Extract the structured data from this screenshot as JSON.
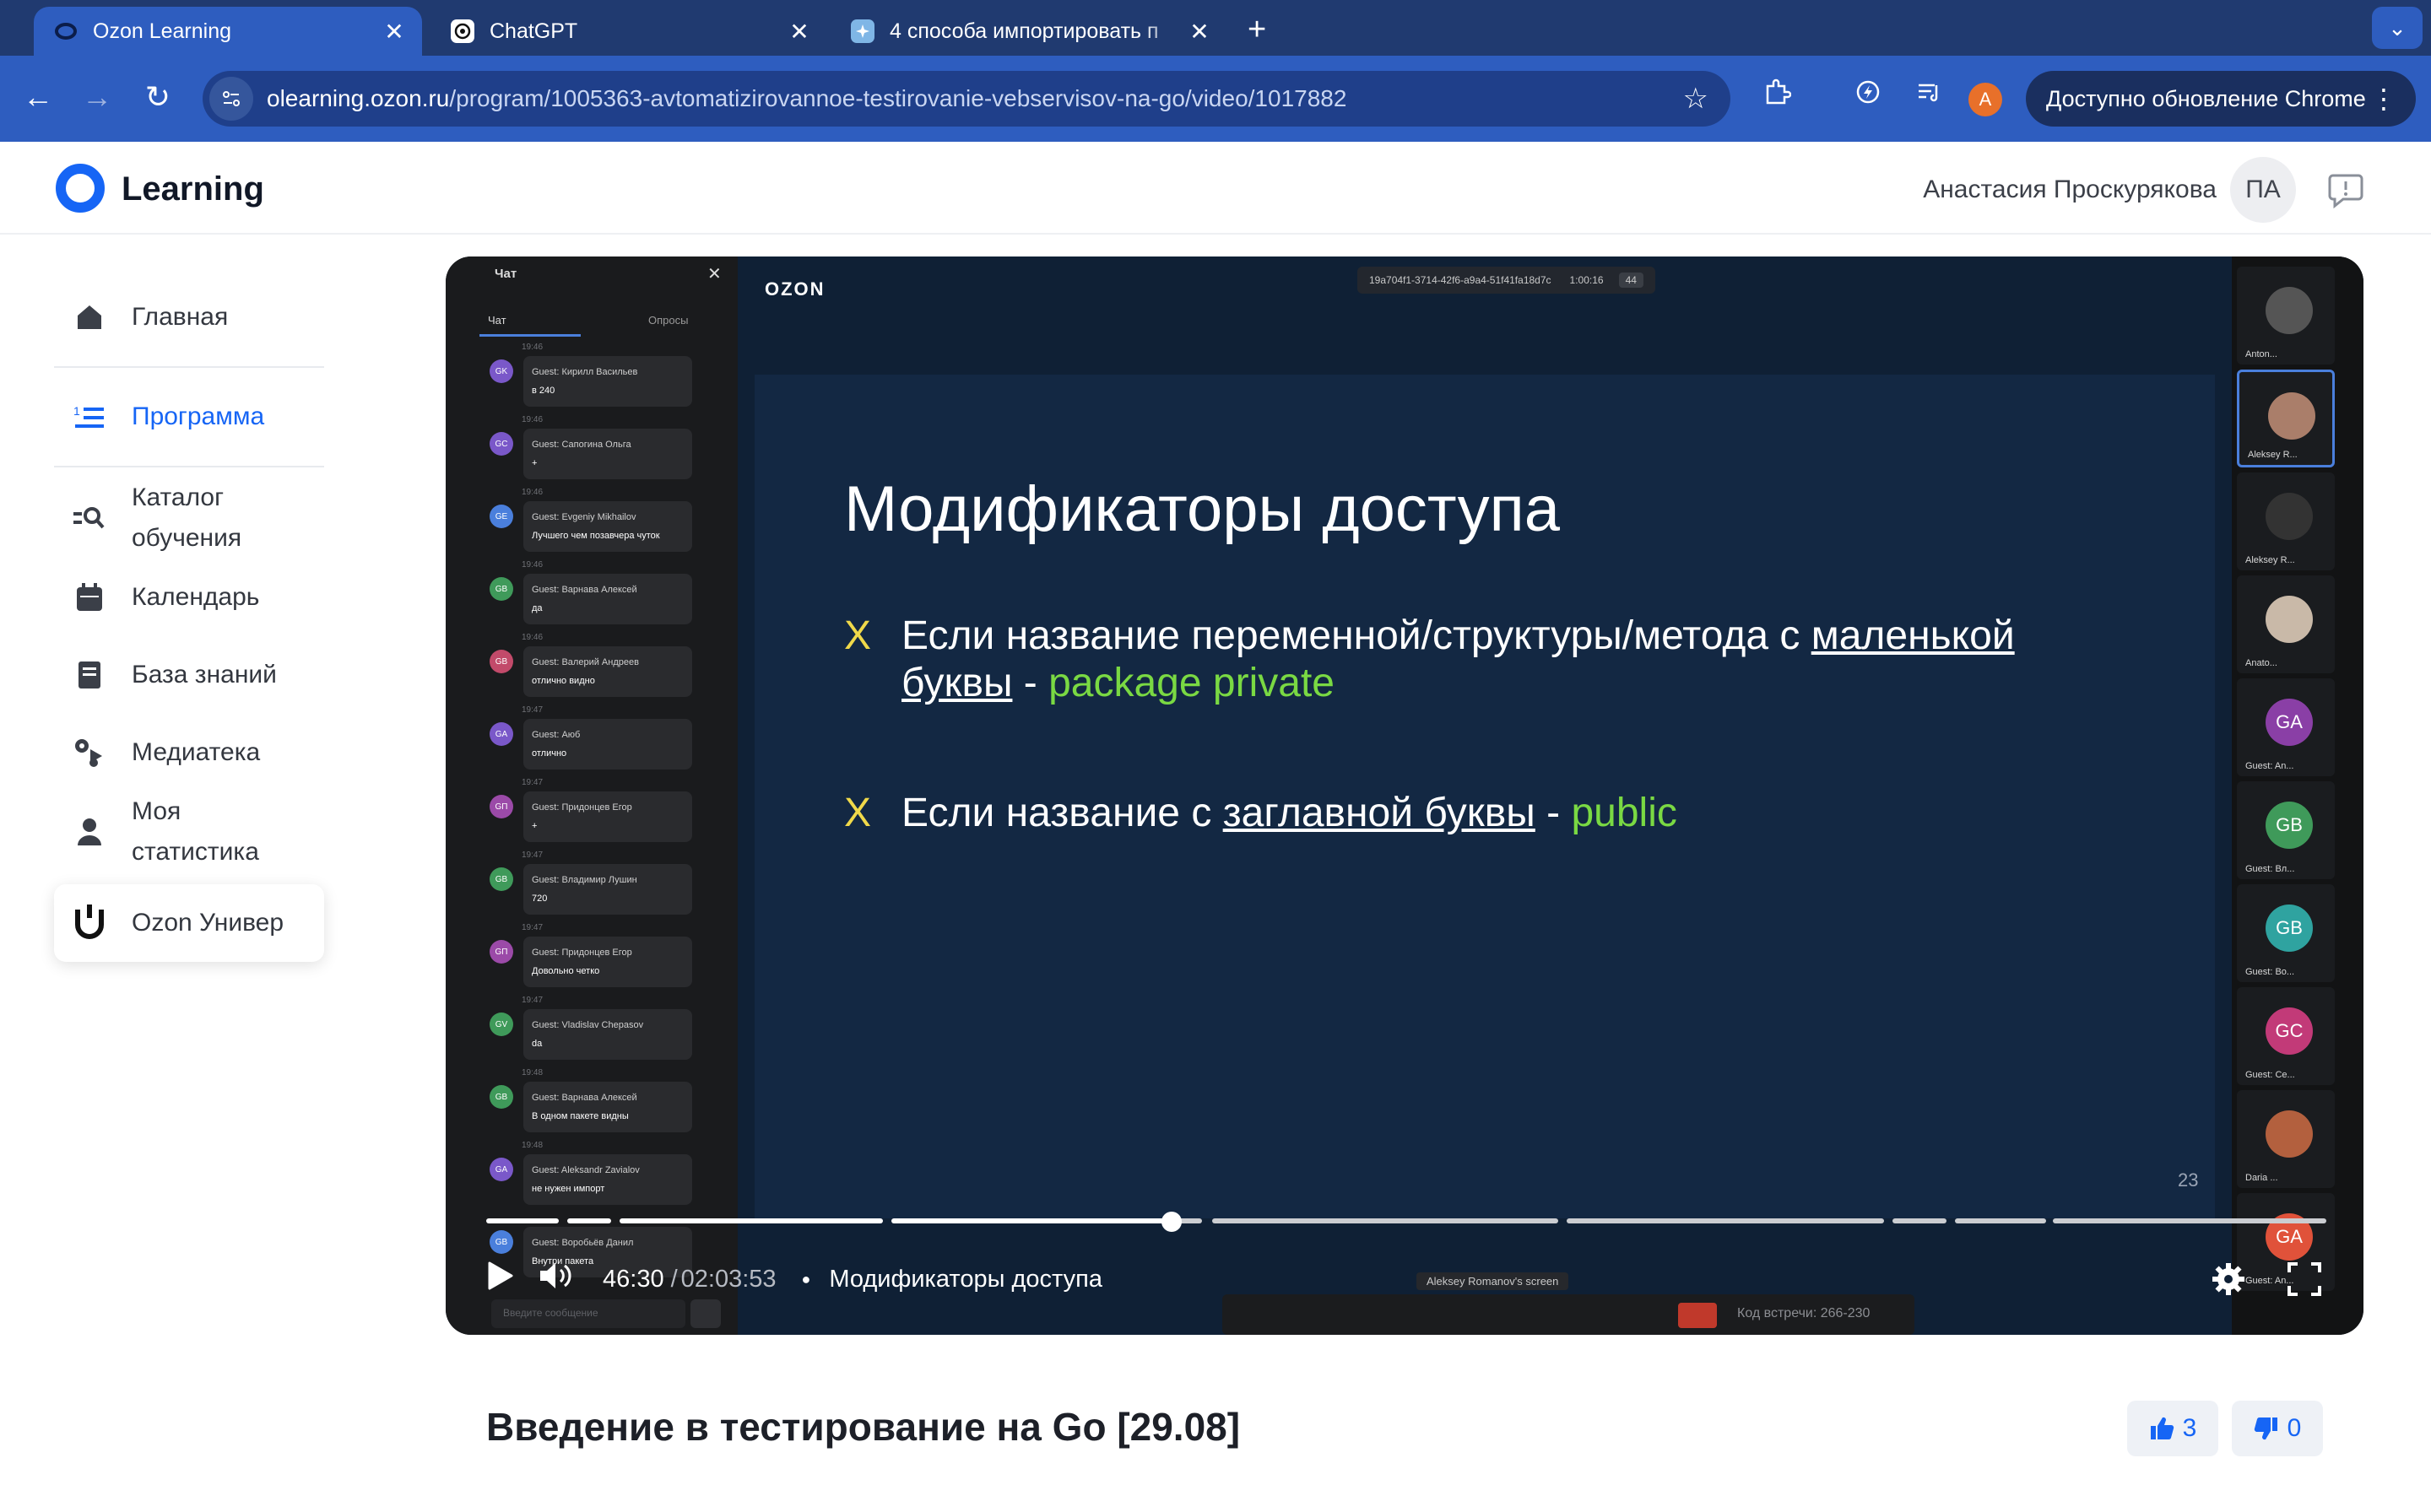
{
  "browser": {
    "tabs": [
      {
        "title": "Ozon Learning",
        "active": true
      },
      {
        "title": "ChatGPT",
        "active": false
      },
      {
        "title": "4 способа импортировать п",
        "active": false
      }
    ],
    "url_host": "olearning.ozon.ru",
    "url_path": "/program/1005363-avtomatizirovannoe-testirovanie-vebservisov-na-go/video/1017882",
    "profile_initial": "A",
    "update_label": "Доступно обновление Chrome"
  },
  "header": {
    "logo_text": "Learning",
    "user_name": "Анастасия Проскурякова",
    "avatar_initials": "ПА"
  },
  "sidebar": {
    "items": [
      {
        "label": "Главная",
        "icon": "home-icon"
      },
      {
        "label": "Программа",
        "icon": "list-icon"
      },
      {
        "label": "Каталог обучения",
        "icon": "catalog-search-icon"
      },
      {
        "label": "Календарь",
        "icon": "calendar-icon"
      },
      {
        "label": "База знаний",
        "icon": "book-icon"
      },
      {
        "label": "Медиатека",
        "icon": "media-icon"
      },
      {
        "label": "Моя статистика",
        "icon": "user-icon"
      },
      {
        "label": "Ozon Универ",
        "icon": "univer-logo-icon"
      }
    ]
  },
  "video": {
    "chat": {
      "title": "Чат",
      "tab_chat": "Чат",
      "tab_polls": "Опросы",
      "messages": [
        {
          "initials": "GK",
          "name": "Guest: Кирилл Васильев",
          "text": "в 240",
          "time": "19:46",
          "color": "#7a58c9"
        },
        {
          "initials": "GC",
          "name": "Guest: Сапогина Ольга",
          "text": "+",
          "time": "19:46",
          "color": "#7a58c9"
        },
        {
          "initials": "GE",
          "name": "Guest: Evgeniy Mikhailov",
          "text": "Лучшего чем позавчера чуток",
          "time": "19:46",
          "color": "#4a7fdc"
        },
        {
          "initials": "GB",
          "name": "Guest: Варнава Алексей",
          "text": "да",
          "time": "19:46",
          "color": "#3f9a5a"
        },
        {
          "initials": "GB",
          "name": "Guest: Валерий Андреев",
          "text": "отлично видно",
          "time": "19:46",
          "color": "#c24a6a"
        },
        {
          "initials": "GA",
          "name": "Guest: Аюб",
          "text": "отлично",
          "time": "19:47",
          "color": "#7a58c9"
        },
        {
          "initials": "GП",
          "name": "Guest: Придонцев Егор",
          "text": "+",
          "time": "19:47",
          "color": "#9b4aa8"
        },
        {
          "initials": "GB",
          "name": "Guest: Владимир Лушин",
          "text": "720",
          "time": "19:47",
          "color": "#3f9a5a"
        },
        {
          "initials": "GП",
          "name": "Guest: Придонцев Егор",
          "text": "Довольно четко",
          "time": "19:47",
          "color": "#9b4aa8"
        },
        {
          "initials": "GV",
          "name": "Guest: Vladislav Chepasov",
          "text": "da",
          "time": "19:47",
          "color": "#3f9a5a"
        },
        {
          "initials": "GB",
          "name": "Guest: Варнава Алексей",
          "text": "В одном пакете видны",
          "time": "19:48",
          "color": "#3f9a5a"
        },
        {
          "initials": "GA",
          "name": "Guest: Aleksandr Zavialov",
          "text": "не нужен импорт",
          "time": "19:48",
          "color": "#7a58c9"
        },
        {
          "initials": "GB",
          "name": "Guest: Воробьёв Данил",
          "text": "Внутри пакета",
          "time": "",
          "color": "#4a7fdc"
        }
      ],
      "input_placeholder": "Введите сообщение"
    },
    "meeting_id": "19a704f1-3714-42f6-a9a4-51f41fa18d7c",
    "meeting_timer": "1:00:16",
    "meeting_count": "44",
    "brand": "OZON",
    "slide": {
      "title": "Модификаторы доступа",
      "bullet1_part1": "Если название переменной/структуры/метода с ",
      "bullet1_underline1": "маленькой",
      "bullet1_underline2": "буквы",
      "bullet1_dash": " - ",
      "bullet1_green": "package private",
      "bullet2_part1": "Если название с ",
      "bullet2_underline": "заглавной буквы",
      "bullet2_dash": " - ",
      "bullet2_green": "public",
      "marker": "X",
      "page_number": "23"
    },
    "participants": [
      {
        "initials": "",
        "name": "Anton...",
        "color": "#555"
      },
      {
        "initials": "",
        "name": "Aleksey R...",
        "color": "#aa7e6a"
      },
      {
        "initials": "",
        "name": "Aleksey R...",
        "color": "#333"
      },
      {
        "initials": "",
        "name": "Anato...",
        "color": "#c9b9a8"
      },
      {
        "initials": "GA",
        "name": "Guest: An...",
        "color": "#8a3fa6"
      },
      {
        "initials": "GB",
        "name": "Guest: Bл...",
        "color": "#3f9a5a"
      },
      {
        "initials": "GB",
        "name": "Guest: Bo...",
        "color": "#2fa3a0"
      },
      {
        "initials": "GC",
        "name": "Guest: Cе...",
        "color": "#c23a78"
      },
      {
        "initials": "",
        "name": "Daria ...",
        "color": "#b3603e"
      },
      {
        "initials": "GA",
        "name": "Guest: An...",
        "color": "#e0523a"
      }
    ],
    "screen_share_label": "Aleksey Romanov's screen",
    "meeting_code": "Код встречи: 266-230",
    "current_time": "46:30",
    "duration": "02:03:53",
    "progress": 0.374,
    "chapter_title": "Модификаторы доступа"
  },
  "lesson": {
    "title": "Введение в тестирование на Go [29.08]",
    "likes": "3",
    "dislikes": "0"
  },
  "colors": {
    "accent": "#1665f5",
    "tab_bar": "#203a70",
    "toolbar": "#2e5dbf"
  }
}
